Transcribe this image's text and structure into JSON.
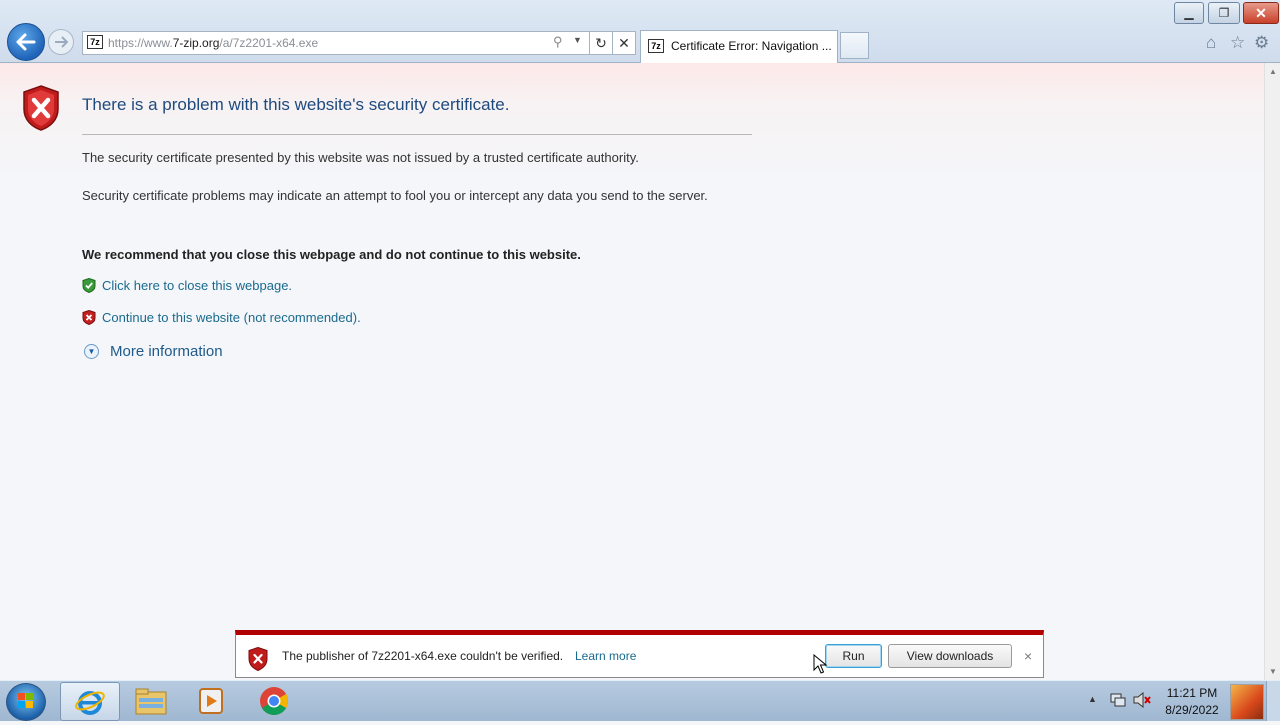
{
  "browser": {
    "url_prefix": "https://www.",
    "url_domain": "7-zip.org",
    "url_path": "/a/7z2201-x64.exe",
    "favicon_text": "7z",
    "tab_title": "Certificate Error: Navigation ...",
    "icons": {
      "back": "back-arrow-icon",
      "forward": "forward-arrow-icon",
      "search": "search-icon",
      "refresh": "refresh-icon",
      "stop": "stop-x-icon",
      "home": "home-icon",
      "favorites": "star-icon",
      "tools": "gear-icon"
    }
  },
  "page": {
    "heading": "There is a problem with this website's security certificate.",
    "paragraph_1": "The security certificate presented by this website was not issued by a trusted certificate authority.",
    "paragraph_2": "Security certificate problems may indicate an attempt to fool you or intercept any data you send to the server.",
    "recommendation": "We recommend that you close this webpage and do not continue to this website.",
    "close_link": "Click here to close this webpage.",
    "continue_link": "Continue to this website (not recommended).",
    "more_info": "More information"
  },
  "notification": {
    "message": "The publisher of 7z2201-x64.exe couldn't be verified.",
    "learn_more": "Learn more",
    "run_label": "Run",
    "view_downloads_label": "View downloads",
    "close_glyph": "×"
  },
  "taskbar": {
    "items": [
      "start-orb",
      "internet-explorer",
      "windows-explorer",
      "media-player",
      "google-chrome"
    ],
    "time": "11:21 PM",
    "date": "8/29/2022"
  },
  "colors": {
    "error_red": "#b00000",
    "link_blue": "#1a6a8f",
    "heading_blue": "#1f4a7d"
  }
}
